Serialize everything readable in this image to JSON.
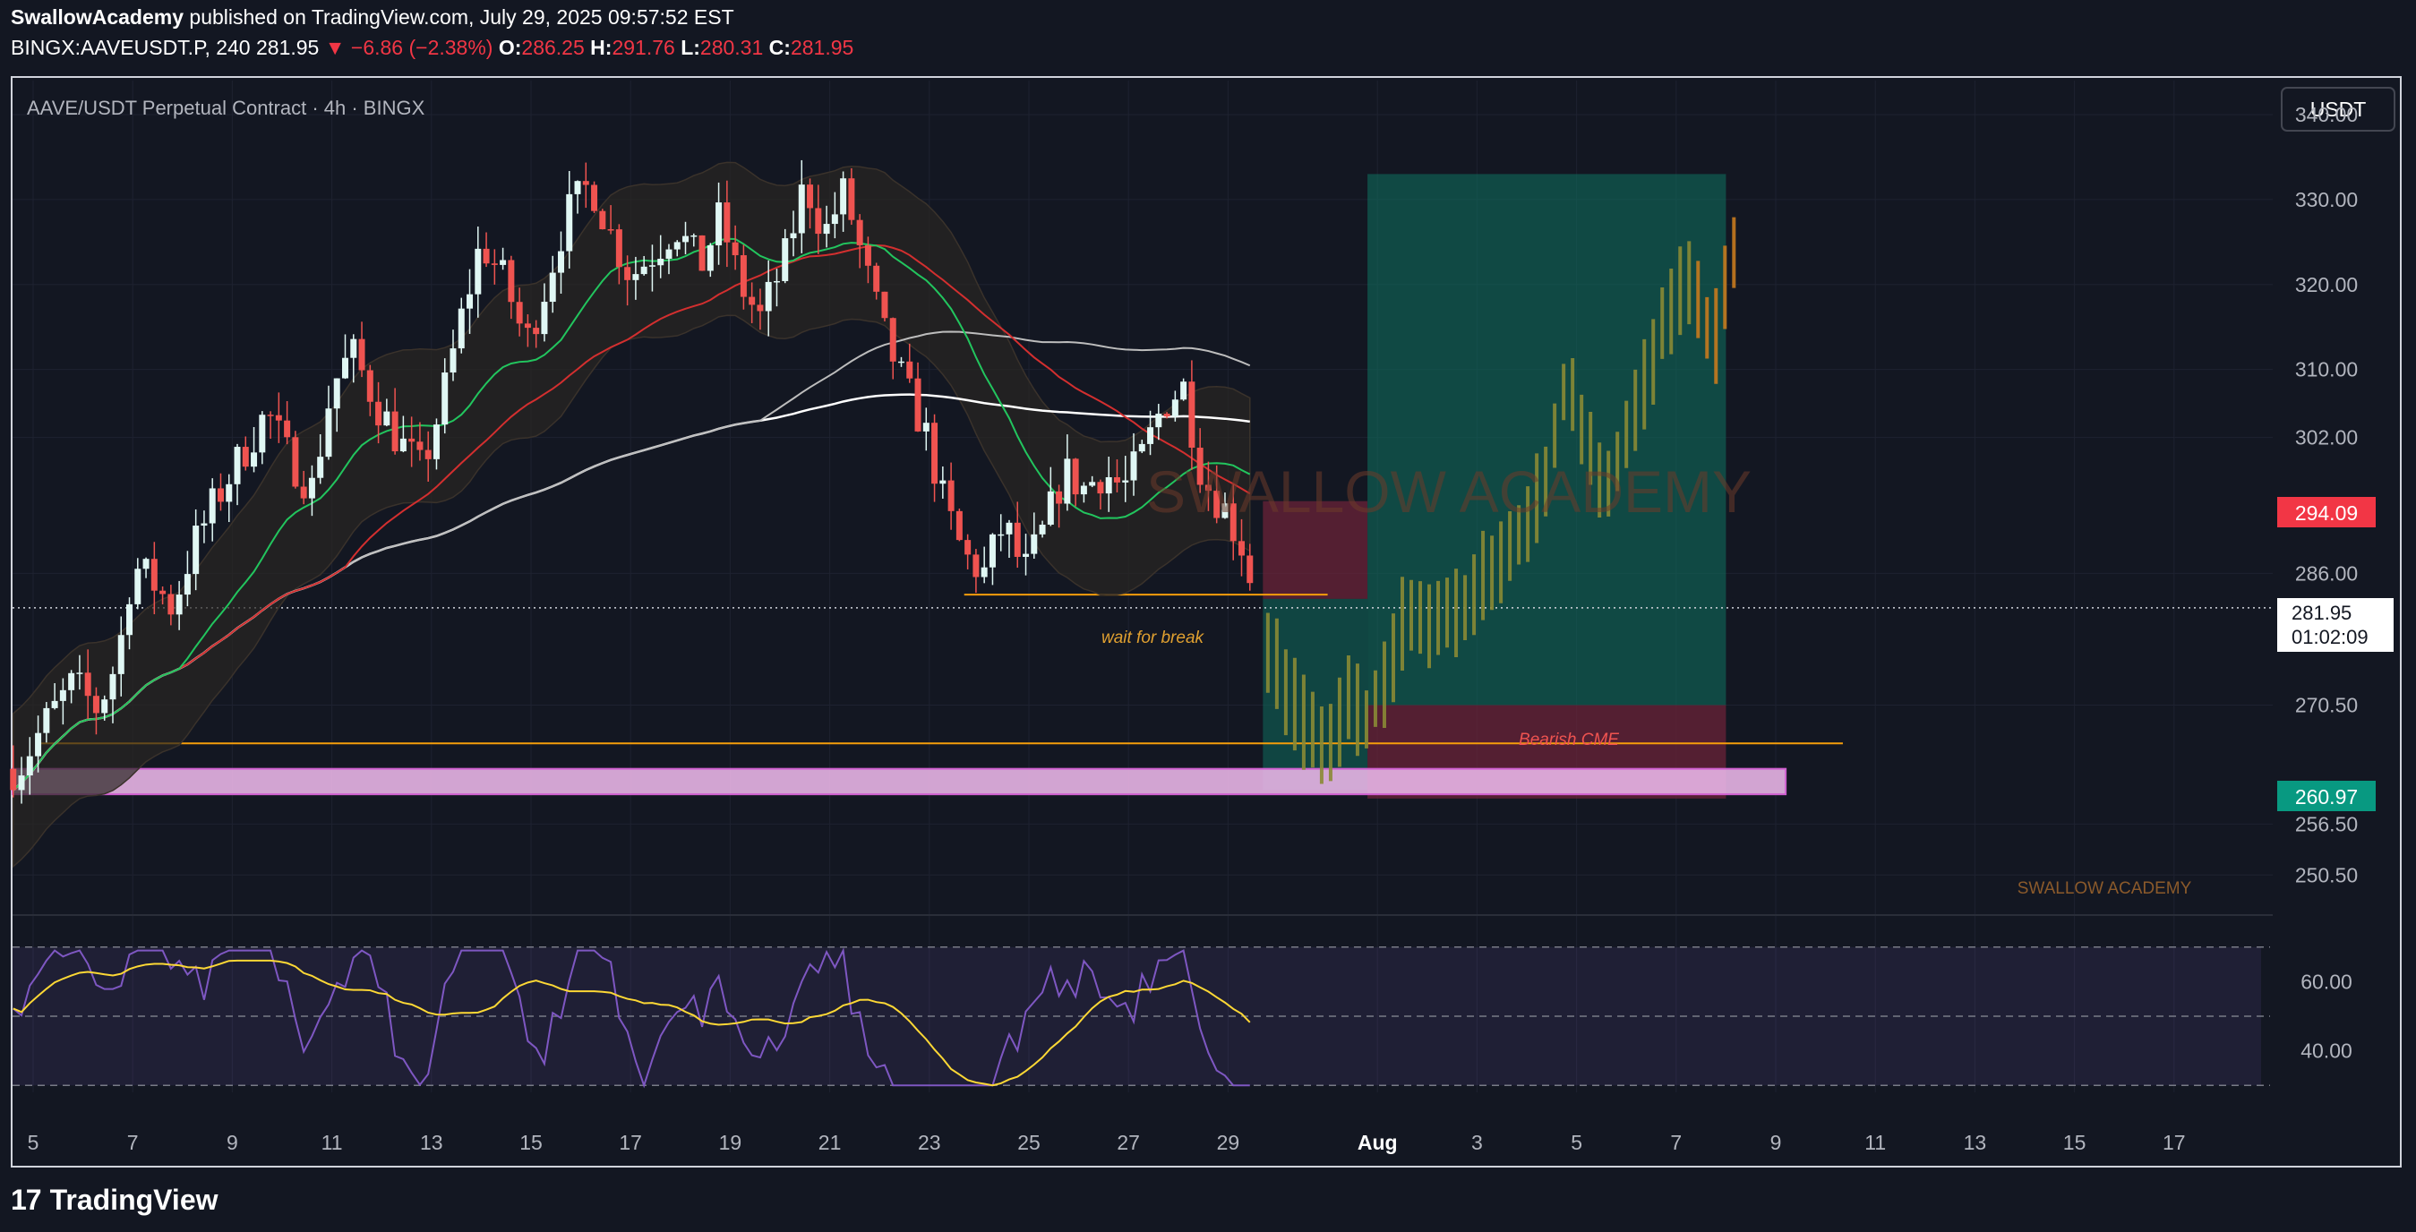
{
  "header": {
    "author": "SwallowAcademy",
    "published": "published on TradingView.com, July 29, 2025 09:57:52 EST",
    "symbol": "BINGX:AAVEUSDT.P, 240",
    "last": "281.95",
    "arrow": "▼",
    "change": "−6.86 (−2.38%)",
    "o_label": "O:",
    "o_value": "286.25",
    "h_label": "H:",
    "h_value": "291.76",
    "l_label": "L:",
    "l_value": "280.31",
    "c_label": "C:",
    "c_value": "281.95"
  },
  "chart_title": "AAVE/USDT Perpetual Contract · 4h · BINGX",
  "currency_button": "USDT",
  "price_axis": {
    "ticks": [
      "340.00",
      "330.00",
      "320.00",
      "310.00",
      "302.00",
      "286.00",
      "270.50",
      "256.50",
      "250.50"
    ],
    "badges": {
      "red": "294.09",
      "current": "281.95",
      "countdown": "01:02:09",
      "green": "260.97"
    }
  },
  "rsi_axis": {
    "ticks": [
      "60.00",
      "40.00"
    ]
  },
  "time_axis": [
    "5",
    "7",
    "9",
    "11",
    "13",
    "15",
    "17",
    "19",
    "21",
    "23",
    "25",
    "27",
    "29",
    "Aug",
    "3",
    "5",
    "7",
    "9",
    "11",
    "13",
    "15",
    "17"
  ],
  "annotations": {
    "wait_for_break": "wait for break",
    "bearish_cme": "Bearish CME",
    "watermark_center": "SWALLOW ACADEMY",
    "watermark_corner": "SWALLOW ACADEMY"
  },
  "footer": {
    "brand": "TradingView",
    "logo": "17"
  },
  "colors": {
    "background": "#131722",
    "candle_up": "#e0f7f4",
    "candle_down": "#ef5350",
    "ema_fast": "#22c55e",
    "ema_mid": "#d32f2f",
    "sma_200": "#ffffff",
    "sma_100": "#bdbdbd",
    "target_zone": "#0f6b5c",
    "stop_zone": "#6b2338",
    "support_zone": "#e8b4e6",
    "projection": "#8a8a35",
    "rsi": "#7e57c2",
    "rsi_ma": "#fdd835"
  },
  "chart_data": {
    "type": "candlestick",
    "title": "AAVE/USDT Perpetual Contract · 4h · BINGX",
    "timeframe": "4h",
    "y_range": [
      246,
      344
    ],
    "rsi_range": [
      28,
      72
    ],
    "x_labels": [
      "5",
      "7",
      "9",
      "11",
      "13",
      "15",
      "17",
      "19",
      "21",
      "23",
      "25",
      "27",
      "29",
      "Aug",
      "3",
      "5",
      "7",
      "9",
      "11",
      "13",
      "15",
      "17"
    ],
    "close_path": [
      {
        "day": 4.7,
        "close": 263
      },
      {
        "day": 5.2,
        "close": 268
      },
      {
        "day": 5.8,
        "close": 273
      },
      {
        "day": 6.3,
        "close": 270
      },
      {
        "day": 6.7,
        "close": 276
      },
      {
        "day": 7.0,
        "close": 287
      },
      {
        "day": 7.4,
        "close": 285
      },
      {
        "day": 7.8,
        "close": 282
      },
      {
        "day": 8.2,
        "close": 289
      },
      {
        "day": 8.7,
        "close": 295
      },
      {
        "day": 9.2,
        "close": 300
      },
      {
        "day": 9.7,
        "close": 305
      },
      {
        "day": 10.1,
        "close": 300
      },
      {
        "day": 10.6,
        "close": 296
      },
      {
        "day": 11.0,
        "close": 308
      },
      {
        "day": 11.4,
        "close": 312
      },
      {
        "day": 11.9,
        "close": 306
      },
      {
        "day": 12.3,
        "close": 302
      },
      {
        "day": 12.8,
        "close": 298
      },
      {
        "day": 13.2,
        "close": 306
      },
      {
        "day": 13.6,
        "close": 316
      },
      {
        "day": 14.0,
        "close": 325
      },
      {
        "day": 14.5,
        "close": 320
      },
      {
        "day": 14.9,
        "close": 313
      },
      {
        "day": 15.3,
        "close": 320
      },
      {
        "day": 15.7,
        "close": 328
      },
      {
        "day": 16.2,
        "close": 332
      },
      {
        "day": 16.6,
        "close": 326
      },
      {
        "day": 17.0,
        "close": 321
      },
      {
        "day": 17.5,
        "close": 324
      },
      {
        "day": 17.9,
        "close": 327
      },
      {
        "day": 18.4,
        "close": 322
      },
      {
        "day": 18.8,
        "close": 328
      },
      {
        "day": 19.2,
        "close": 320
      },
      {
        "day": 19.6,
        "close": 316
      },
      {
        "day": 20.1,
        "close": 323
      },
      {
        "day": 20.5,
        "close": 332
      },
      {
        "day": 20.9,
        "close": 326
      },
      {
        "day": 21.3,
        "close": 331
      },
      {
        "day": 21.7,
        "close": 322
      },
      {
        "day": 22.1,
        "close": 314
      },
      {
        "day": 22.5,
        "close": 308
      },
      {
        "day": 22.9,
        "close": 303
      },
      {
        "day": 23.3,
        "close": 294
      },
      {
        "day": 23.7,
        "close": 288
      },
      {
        "day": 24.1,
        "close": 286
      },
      {
        "day": 24.5,
        "close": 292
      },
      {
        "day": 24.9,
        "close": 286
      },
      {
        "day": 25.3,
        "close": 291
      },
      {
        "day": 25.7,
        "close": 298
      },
      {
        "day": 26.1,
        "close": 296
      },
      {
        "day": 26.5,
        "close": 298
      },
      {
        "day": 26.9,
        "close": 296
      },
      {
        "day": 27.3,
        "close": 300
      },
      {
        "day": 27.7,
        "close": 306
      },
      {
        "day": 28.1,
        "close": 308
      },
      {
        "day": 28.5,
        "close": 297
      },
      {
        "day": 28.9,
        "close": 294
      },
      {
        "day": 29.3,
        "close": 289
      },
      {
        "day": 29.6,
        "close": 282
      }
    ],
    "projection_path": [
      {
        "day": 29.7,
        "close": 279
      },
      {
        "day": 30.2,
        "close": 272
      },
      {
        "day": 30.6,
        "close": 268
      },
      {
        "day": 31.0,
        "close": 264
      },
      {
        "day": 31.4,
        "close": 271
      },
      {
        "day": 31.8,
        "close": 269
      },
      {
        "day": 32.2,
        "close": 274
      },
      {
        "day": 32.6,
        "close": 282
      },
      {
        "day": 33.0,
        "close": 280
      },
      {
        "day": 33.4,
        "close": 281
      },
      {
        "day": 33.8,
        "close": 282
      },
      {
        "day": 34.2,
        "close": 286
      },
      {
        "day": 34.6,
        "close": 288
      },
      {
        "day": 35.0,
        "close": 292
      },
      {
        "day": 35.4,
        "close": 297
      },
      {
        "day": 35.8,
        "close": 309
      },
      {
        "day": 36.2,
        "close": 302
      },
      {
        "day": 36.6,
        "close": 296
      },
      {
        "day": 37.0,
        "close": 302
      },
      {
        "day": 37.4,
        "close": 309
      },
      {
        "day": 37.8,
        "close": 316
      },
      {
        "day": 38.2,
        "close": 320
      },
      {
        "day": 38.5,
        "close": 316
      },
      {
        "day": 38.8,
        "close": 314
      },
      {
        "day": 39.1,
        "close": 323
      },
      {
        "day": 39.3,
        "close": 327
      }
    ],
    "levels": {
      "entry": 283,
      "target": 333,
      "stop": 263,
      "wait_line": 283.5,
      "orange_line": 266,
      "support_zone": [
        260,
        263
      ]
    },
    "rsi_levels": [
      70,
      50,
      30
    ]
  }
}
